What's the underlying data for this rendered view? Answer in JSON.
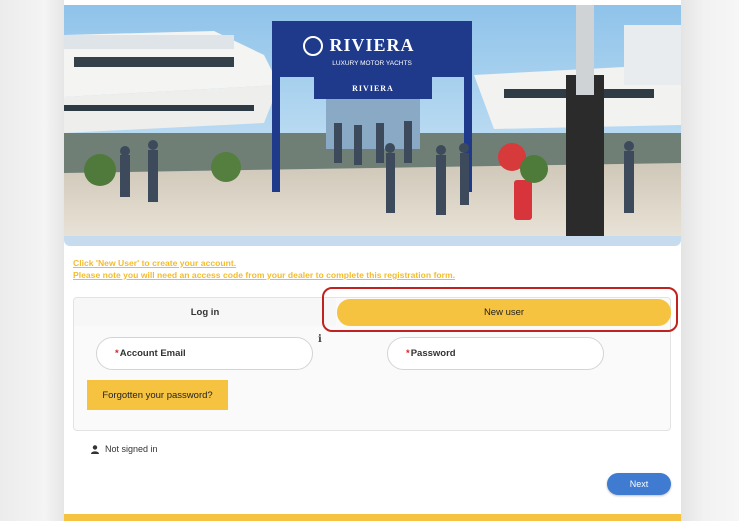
{
  "hero": {
    "brand_name": "RIVIERA",
    "brand_tagline": "LUXURY MOTOR YACHTS",
    "booth_sign": "RIVIERA"
  },
  "notices": {
    "line1": "Click 'New User' to create your account.",
    "line2": "Please note you will need an access code from your dealer to complete this registration form."
  },
  "tabs": {
    "login_label": "Log in",
    "new_user_label": "New user"
  },
  "form": {
    "email_label": "Account Email",
    "password_label": "Password",
    "required_marker": "*",
    "info_glyph": "i",
    "forgot_label": "Forgotten your password?"
  },
  "status": {
    "signed_in_text": "Not signed in"
  },
  "actions": {
    "next_label": "Next"
  },
  "colors": {
    "accent_yellow": "#f6c341",
    "notice_yellow": "#f3bc2c",
    "highlight_red": "#c0221f",
    "next_blue": "#3f7bd0",
    "brand_navy": "#1f3a8a"
  }
}
